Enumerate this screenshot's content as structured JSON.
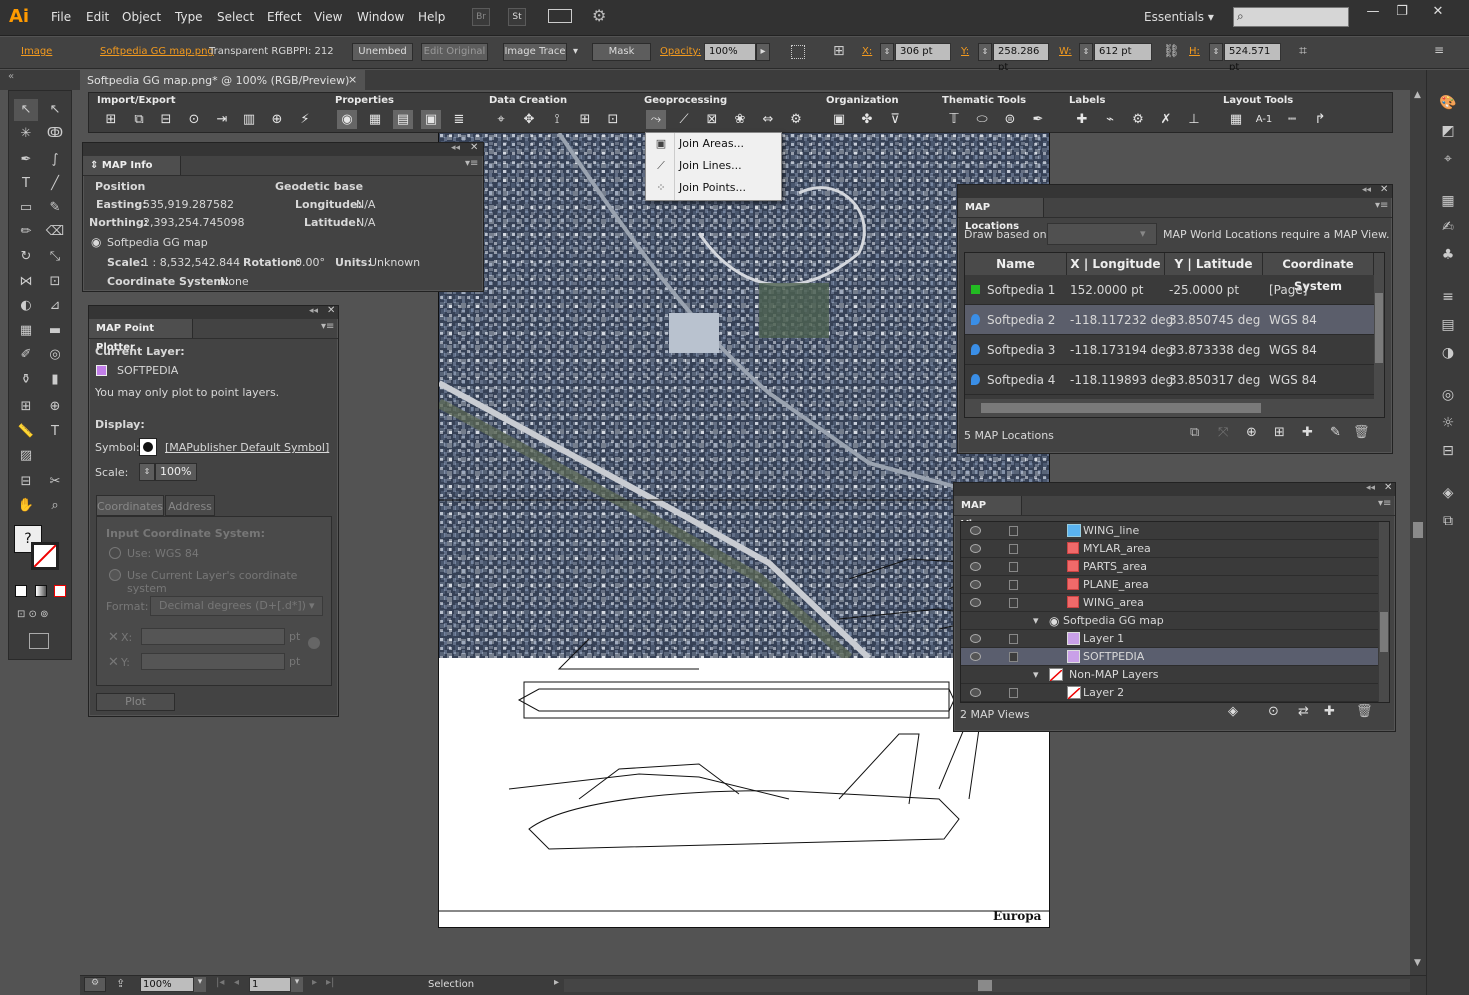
{
  "app": {
    "logo": "Ai"
  },
  "menu": [
    "File",
    "Edit",
    "Object",
    "Type",
    "Select",
    "Effect",
    "View",
    "Window",
    "Help"
  ],
  "menu_buttons": [
    "Br",
    "St"
  ],
  "workspace": "Essentials",
  "control_bar": {
    "image_label": "Image",
    "file_name": "Softpedia GG map.png",
    "color_mode": "Transparent RGB",
    "ppi": "PPI: 212",
    "embed_btn": "Unembed",
    "edit_original_btn": "Edit Original",
    "image_trace_btn": "Image Trace",
    "mask_btn": "Mask",
    "opacity_label": "Opacity:",
    "opacity_value": "100%",
    "x_label": "X:",
    "x_value": "306 pt",
    "y_label": "Y:",
    "y_value": "258.286 pt",
    "w_label": "W:",
    "w_value": "612 pt",
    "h_label": "H:",
    "h_value": "524.571 pt"
  },
  "doc_tab": {
    "title": "Softpedia GG map.png* @ 100% (RGB/Preview)",
    "close": "×"
  },
  "map_toolbar": {
    "groups": [
      "Import/Export",
      "Properties",
      "Data Creation",
      "Geoprocessing",
      "Organization",
      "Thematic Tools",
      "Labels",
      "Layout Tools"
    ]
  },
  "geoprocessing_menu": [
    "Join Areas...",
    "Join Lines...",
    "Join Points..."
  ],
  "map_info": {
    "title": "MAP Info",
    "position_heading": "Position",
    "easting_label": "Easting:",
    "easting_value": "535,919.287582",
    "northing_label": "Northing:",
    "northing_value": "2,393,254.745098",
    "geodetic_heading": "Geodetic base",
    "longitude_label": "Longitude:",
    "longitude_value": "N/A",
    "latitude_label": "Latitude:",
    "latitude_value": "N/A",
    "map_name": "Softpedia GG map",
    "scale_label": "Scale:",
    "scale_value": "1 : 8,532,542.844",
    "rotation_label": "Rotation:",
    "rotation_value": "0.00°",
    "units_label": "Units:",
    "units_value": "Unknown",
    "coord_label": "Coordinate System:",
    "coord_value": "None"
  },
  "point_plotter": {
    "title": "MAP Point Plotter",
    "current_layer_label": "Current Layer:",
    "current_layer": "SOFTPEDIA",
    "note": "You may only plot to point layers.",
    "display_label": "Display:",
    "symbol_label": "Symbol:",
    "symbol_value": "[MAPublisher Default Symbol]",
    "scale_label": "Scale:",
    "scale_value": "100%",
    "tab_coordinates": "Coordinates",
    "tab_address": "Address",
    "input_cs_label": "Input Coordinate System:",
    "use_label": "Use:",
    "use_value": "WGS 84",
    "use_current": "Use Current Layer's coordinate system",
    "format_label": "Format:",
    "format_value": "Decimal degrees (D+[.d*])",
    "x_label": "X:",
    "y_label": "Y:",
    "unit": "pt",
    "plot_btn": "Plot"
  },
  "map_locations": {
    "title": "MAP Locations",
    "draw_based_on": "Draw based on:",
    "note": "MAP World Locations require a MAP View.",
    "columns": [
      "Name",
      "X | Longitude",
      "Y | Latitude",
      "Coordinate System"
    ],
    "rows": [
      {
        "name": "Softpedia 1",
        "x": "152.0000 pt",
        "y": "-25.0000 pt",
        "cs": "[Page]",
        "color": "#22bb22"
      },
      {
        "name": "Softpedia 2",
        "x": "-118.117232 deg",
        "y": "33.850745 deg",
        "cs": "WGS 84",
        "color": "#3a8ee6"
      },
      {
        "name": "Softpedia 3",
        "x": "-118.173194 deg",
        "y": "33.873338 deg",
        "cs": "WGS 84",
        "color": "#3a8ee6"
      },
      {
        "name": "Softpedia 4",
        "x": "-118.119893 deg",
        "y": "33.850317 deg",
        "cs": "WGS 84",
        "color": "#3a8ee6"
      }
    ],
    "count": "5 MAP Locations"
  },
  "map_views": {
    "title": "MAP Views",
    "rows": [
      {
        "label": "WING_line",
        "kind": "line"
      },
      {
        "label": "MYLAR_area",
        "kind": "area"
      },
      {
        "label": "PARTS_area",
        "kind": "area"
      },
      {
        "label": "PLANE_area",
        "kind": "area"
      },
      {
        "label": "WING_area",
        "kind": "area"
      },
      {
        "label": "Softpedia GG map",
        "kind": "view"
      },
      {
        "label": "Layer 1",
        "kind": "layer"
      },
      {
        "label": "SOFTPEDIA",
        "kind": "layer"
      },
      {
        "label": "Non-MAP Layers",
        "kind": "nonmap"
      },
      {
        "label": "Layer 2",
        "kind": "nonmap-layer"
      }
    ],
    "count": "2 MAP Views"
  },
  "statusbar": {
    "zoom": "100%",
    "page": "1",
    "tool": "Selection"
  },
  "artboard_title": "Europa"
}
